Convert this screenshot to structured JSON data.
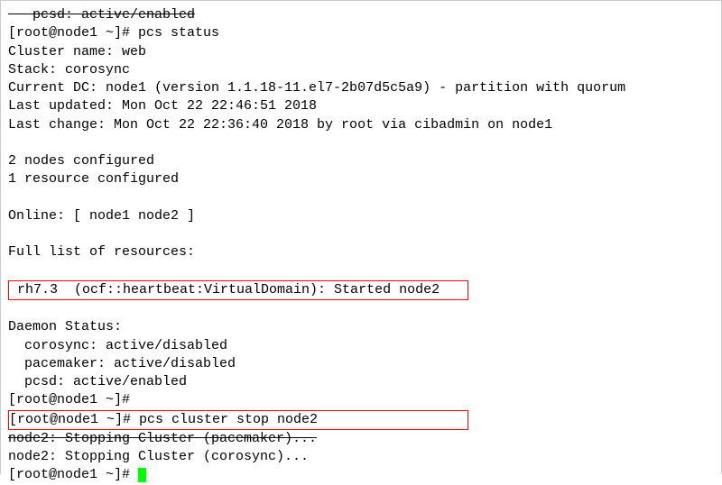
{
  "terminal": {
    "truncated_top": "   pcsd: active/enabled",
    "struck_top": "   pcsd: active/enabled",
    "prompt": "[root@node1 ~]# ",
    "cmd_status": "pcs status",
    "cluster_name": "Cluster name: web",
    "stack": "Stack: corosync",
    "current_dc": "Current DC: node1 (version 1.1.18-11.el7-2b07d5c5a9) - partition with quorum",
    "last_updated": "Last updated: Mon Oct 22 22:46:51 2018",
    "last_change": "Last change: Mon Oct 22 22:36:40 2018 by root via cibadmin on node1",
    "nodes_configured": "2 nodes configured",
    "resource_configured": "1 resource configured",
    "online": "Online: [ node1 node2 ]",
    "full_list": "Full list of resources:",
    "resource_line": " rh7.3  (ocf::heartbeat:VirtualDomain): Started node2   ",
    "daemon_status": "Daemon Status:",
    "corosync_status": "  corosync: active/disabled",
    "pacemaker_status": "  pacemaker: active/disabled",
    "pcsd_status": "  pcsd: active/enabled",
    "cmd_stop_line": "[root@node1 ~]# pcs cluster stop node2             ",
    "stopping_pacemaker": "node2: Stopping Cluster (pacemaker)...",
    "stopping_corosync": "node2: Stopping Cluster (corosync)..."
  }
}
